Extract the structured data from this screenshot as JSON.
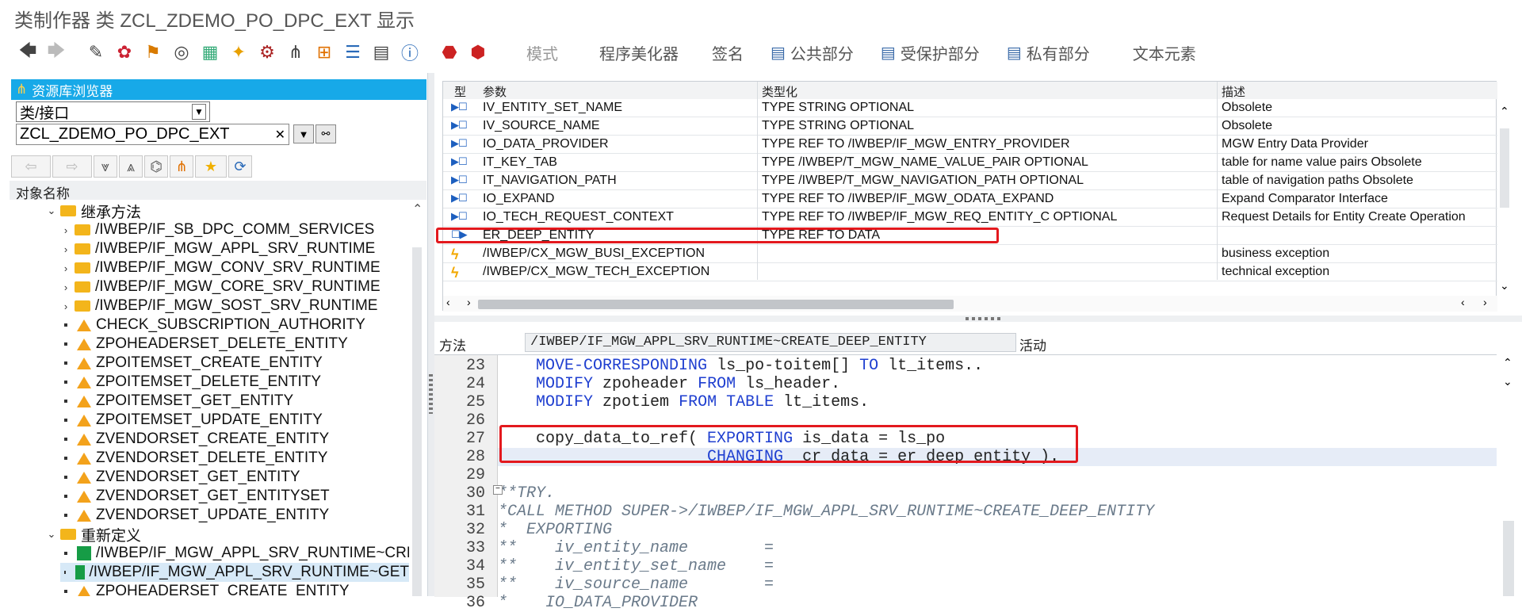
{
  "window": {
    "title": "类制作器 类 ZCL_ZDEMO_PO_DPC_EXT 显示"
  },
  "toolbar": {
    "icons": [
      "back-icon",
      "forward-icon",
      "display-change-icon",
      "activate-icon",
      "check-icon",
      "where-used-icon",
      "object-list-icon",
      "navigate-icon",
      "test-icon",
      "hierarchy-icon",
      "stack-icon",
      "table-icon",
      "info-icon",
      "breakpoint-icon",
      "session-breakpoint-icon"
    ],
    "pattern_label": "模式",
    "pretty_printer_label": "程序美化器",
    "signature_label": "签名",
    "public_label": "公共部分",
    "protected_label": "受保护部分",
    "private_label": "私有部分",
    "text_elements_label": "文本元素"
  },
  "repo": {
    "header": "资源库浏览器",
    "type_select": "类/接口",
    "class_name": "ZCL_ZDEMO_PO_DPC_EXT",
    "clear_symbol": "✕"
  },
  "objlist": {
    "header": "对象名称"
  },
  "tree": {
    "inherited_folder": "继承方法",
    "inherited": [
      "/IWBEP/IF_SB_DPC_COMM_SERVICES",
      "/IWBEP/IF_MGW_APPL_SRV_RUNTIME",
      "/IWBEP/IF_MGW_CONV_SRV_RUNTIME",
      "/IWBEP/IF_MGW_CORE_SRV_RUNTIME",
      "/IWBEP/IF_MGW_SOST_SRV_RUNTIME"
    ],
    "methods": [
      "CHECK_SUBSCRIPTION_AUTHORITY",
      "ZPOHEADERSET_DELETE_ENTITY",
      "ZPOITEMSET_CREATE_ENTITY",
      "ZPOITEMSET_DELETE_ENTITY",
      "ZPOITEMSET_GET_ENTITY",
      "ZPOITEMSET_UPDATE_ENTITY",
      "ZVENDORSET_CREATE_ENTITY",
      "ZVENDORSET_DELETE_ENTITY",
      "ZVENDORSET_GET_ENTITY",
      "ZVENDORSET_GET_ENTITYSET",
      "ZVENDORSET_UPDATE_ENTITY"
    ],
    "redefined_folder": "重新定义",
    "redefined": [
      "/IWBEP/IF_MGW_APPL_SRV_RUNTIME~CRE",
      "/IWBEP/IF_MGW_APPL_SRV_RUNTIME~GET",
      "ZPOHEADERSET_CREATE_ENTITY"
    ]
  },
  "params": {
    "headers": {
      "type": "型",
      "param": "参数",
      "typing": "类型化",
      "desc": "描述"
    },
    "rows": [
      {
        "icon": "importing-icon",
        "sym": "▶☐",
        "name": "IV_ENTITY_SET_NAME",
        "typing": "TYPE STRING OPTIONAL",
        "desc": "Obsolete"
      },
      {
        "icon": "importing-icon",
        "sym": "▶☐",
        "name": "IV_SOURCE_NAME",
        "typing": "TYPE STRING OPTIONAL",
        "desc": "Obsolete"
      },
      {
        "icon": "importing-icon",
        "sym": "▶☐",
        "name": "IO_DATA_PROVIDER",
        "typing": "TYPE REF TO /IWBEP/IF_MGW_ENTRY_PROVIDER",
        "desc": "MGW Entry Data Provider"
      },
      {
        "icon": "importing-icon",
        "sym": "▶☐",
        "name": "IT_KEY_TAB",
        "typing": "TYPE /IWBEP/T_MGW_NAME_VALUE_PAIR OPTIONAL",
        "desc": "table for name value pairs Obsolete"
      },
      {
        "icon": "importing-icon",
        "sym": "▶☐",
        "name": "IT_NAVIGATION_PATH",
        "typing": "TYPE /IWBEP/T_MGW_NAVIGATION_PATH OPTIONAL",
        "desc": "table of navigation paths Obsolete"
      },
      {
        "icon": "importing-icon",
        "sym": "▶☐",
        "name": "IO_EXPAND",
        "typing": "TYPE REF TO /IWBEP/IF_MGW_ODATA_EXPAND",
        "desc": "Expand Comparator Interface"
      },
      {
        "icon": "importing-icon",
        "sym": "▶☐",
        "name": "IO_TECH_REQUEST_CONTEXT",
        "typing": "TYPE REF TO /IWBEP/IF_MGW_REQ_ENTITY_C OPTIONAL",
        "desc": "Request Details for Entity Create Operation"
      },
      {
        "icon": "exporting-icon",
        "sym": "☐▶",
        "name": "ER_DEEP_ENTITY",
        "typing": "TYPE REF TO DATA",
        "desc": ""
      },
      {
        "icon": "exception-icon",
        "sym": "ϟ",
        "name": "/IWBEP/CX_MGW_BUSI_EXCEPTION",
        "typing": "",
        "desc": "business exception"
      },
      {
        "icon": "exception-icon",
        "sym": "ϟ",
        "name": "/IWBEP/CX_MGW_TECH_EXCEPTION",
        "typing": "",
        "desc": "technical exception"
      }
    ]
  },
  "method": {
    "label": "方法",
    "name": "/IWBEP/IF_MGW_APPL_SRV_RUNTIME~CREATE_DEEP_ENTITY",
    "status": "活动"
  },
  "code": {
    "lines": [
      {
        "no": "23",
        "segs": [
          {
            "t": "    ",
            "c": ""
          },
          {
            "t": "MOVE-CORRESPONDING",
            "c": "kw"
          },
          {
            "t": " ls_po-toitem[] ",
            "c": ""
          },
          {
            "t": "TO",
            "c": "kw"
          },
          {
            "t": " lt_items..",
            "c": ""
          }
        ]
      },
      {
        "no": "24",
        "segs": [
          {
            "t": "    ",
            "c": ""
          },
          {
            "t": "MODIFY",
            "c": "kw"
          },
          {
            "t": " zpoheader ",
            "c": ""
          },
          {
            "t": "FROM",
            "c": "kw"
          },
          {
            "t": " ls_header.",
            "c": ""
          }
        ]
      },
      {
        "no": "25",
        "segs": [
          {
            "t": "    ",
            "c": ""
          },
          {
            "t": "MODIFY",
            "c": "kw"
          },
          {
            "t": " zpotiem ",
            "c": ""
          },
          {
            "t": "FROM TABLE",
            "c": "kw"
          },
          {
            "t": " lt_items.",
            "c": ""
          }
        ]
      },
      {
        "no": "26",
        "segs": [
          {
            "t": "",
            "c": ""
          }
        ]
      },
      {
        "no": "27",
        "segs": [
          {
            "t": "    copy_data_to_ref( ",
            "c": ""
          },
          {
            "t": "EXPORTING",
            "c": "kw"
          },
          {
            "t": " is_data = ls_po",
            "c": ""
          }
        ]
      },
      {
        "no": "28",
        "segs": [
          {
            "t": "                      ",
            "c": ""
          },
          {
            "t": "CHANGING",
            "c": "kw"
          },
          {
            "t": "  cr_data = er_deep_entity ).",
            "c": ""
          }
        ]
      },
      {
        "no": "29",
        "segs": [
          {
            "t": "",
            "c": ""
          }
        ]
      },
      {
        "no": "30",
        "segs": [
          {
            "t": "**TRY.",
            "c": "cm"
          }
        ]
      },
      {
        "no": "31",
        "segs": [
          {
            "t": "*CALL METHOD SUPER->/IWBEP/IF_MGW_APPL_SRV_RUNTIME~CREATE_DEEP_ENTITY",
            "c": "cm"
          }
        ]
      },
      {
        "no": "32",
        "segs": [
          {
            "t": "*  EXPORTING",
            "c": "cm"
          }
        ]
      },
      {
        "no": "33",
        "segs": [
          {
            "t": "**    iv_entity_name        =",
            "c": "cm"
          }
        ]
      },
      {
        "no": "34",
        "segs": [
          {
            "t": "**    iv_entity_set_name    =",
            "c": "cm"
          }
        ]
      },
      {
        "no": "35",
        "segs": [
          {
            "t": "**    iv_source_name        =",
            "c": "cm"
          }
        ]
      },
      {
        "no": "36",
        "segs": [
          {
            "t": "*    IO_DATA_PROVIDER",
            "c": "cm"
          }
        ]
      }
    ]
  }
}
